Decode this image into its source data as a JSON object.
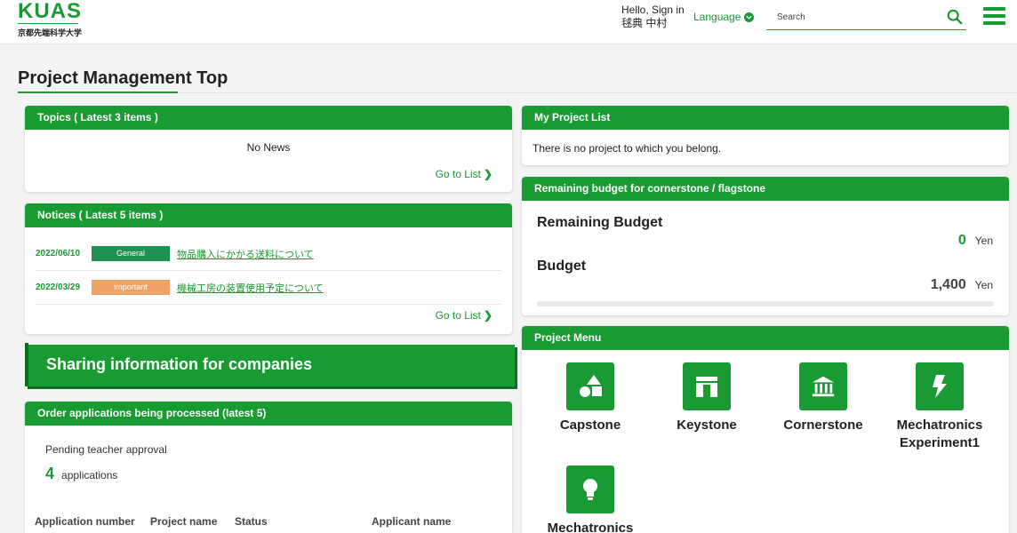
{
  "header": {
    "logo_text": "KUAS",
    "logo_sub": "京都先端科学大学",
    "greeting_line1": "Hello, Sign in",
    "greeting_line2": "毬典 中村",
    "language_label": "Language",
    "search_placeholder": "Search"
  },
  "page": {
    "title": "Project Management Top"
  },
  "topics": {
    "title": "Topics ( Latest 3 items )",
    "empty_text": "No News",
    "goto_label": "Go to List"
  },
  "notices": {
    "title": "Notices ( Latest 5 items )",
    "items": [
      {
        "date": "2022/06/10",
        "badge": "General",
        "text": "物品購入にかかる送料について"
      },
      {
        "date": "2022/03/29",
        "badge": "important",
        "text": "機械工房の装置使用予定について"
      }
    ],
    "goto_label": "Go to List"
  },
  "sharing": {
    "label": "Sharing information for companies"
  },
  "orders": {
    "title": "Order applications being processed (latest 5)",
    "pending_label": "Pending teacher approval",
    "pending_count": "4",
    "pending_unit": "applications",
    "columns": [
      "Application number",
      "Project name",
      "Status",
      "Applicant name"
    ]
  },
  "my_projects": {
    "title": "My Project List",
    "empty_text": "There is no project to which you belong."
  },
  "budget": {
    "title": "Remaining budget for cornerstone / flagstone",
    "remaining_label": "Remaining Budget",
    "remaining_value": "0",
    "budget_label": "Budget",
    "budget_value": "1,400",
    "currency": "Yen",
    "used_fraction": 0
  },
  "project_menu": {
    "title": "Project Menu",
    "items": [
      {
        "label": "Capstone",
        "icon": "shapes-icon"
      },
      {
        "label": "Keystone",
        "icon": "arch-icon"
      },
      {
        "label": "Cornerstone",
        "icon": "institution-icon"
      },
      {
        "label": "Mechatronics Experiment1",
        "icon": "bolt-icon"
      },
      {
        "label": "Mechatronics",
        "icon": "lightbulb-icon"
      }
    ]
  },
  "colors": {
    "accent": "#1a9a33",
    "badge_general": "#1f8f52",
    "badge_important": "#f0a266"
  }
}
